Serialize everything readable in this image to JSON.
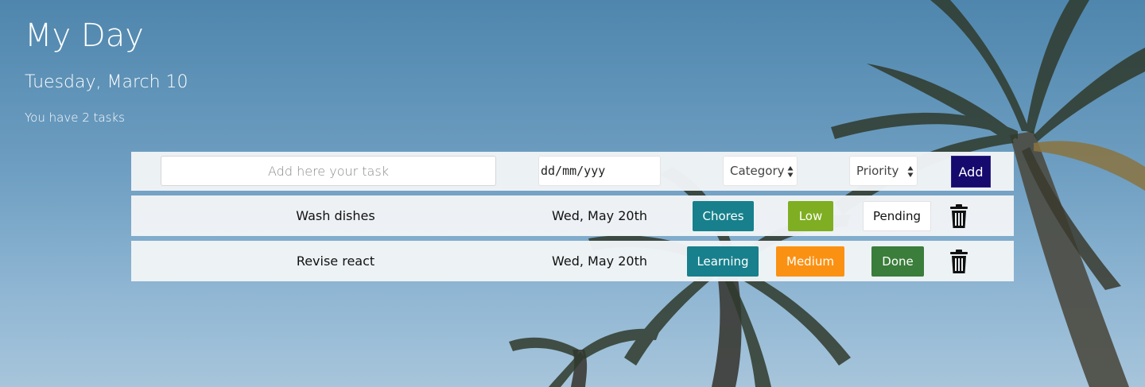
{
  "header": {
    "title": "My Day",
    "date": "Tuesday, March 10",
    "task_count": "You have 2 tasks"
  },
  "form": {
    "task_placeholder": "Add here your task",
    "date_value": "dd/mm/yyy",
    "category_label": "Category",
    "priority_label": "Priority",
    "add_label": "Add"
  },
  "tasks": [
    {
      "name": "Wash dishes",
      "date": "Wed, May 20th",
      "category": "Chores",
      "priority": "Low",
      "status": "Pending",
      "colors": {
        "category": "#17808c",
        "priority": "#7fae22",
        "status_bg": "#ffffff",
        "status_fg": "#111111"
      }
    },
    {
      "name": "Revise react",
      "date": "Wed, May 20th",
      "category": "Learning",
      "priority": "Medium",
      "status": "Done",
      "colors": {
        "category": "#17808c",
        "priority": "#fb9112",
        "status_bg": "#3b7d3a",
        "status_fg": "#ffffff"
      }
    }
  ],
  "icons": {
    "trash": "trash-icon",
    "select_arrows": "sort-arrows-icon"
  },
  "colors": {
    "add_button": "#160a6e",
    "sky_top": "#4f86ad",
    "sky_bottom": "#a7c5db"
  }
}
